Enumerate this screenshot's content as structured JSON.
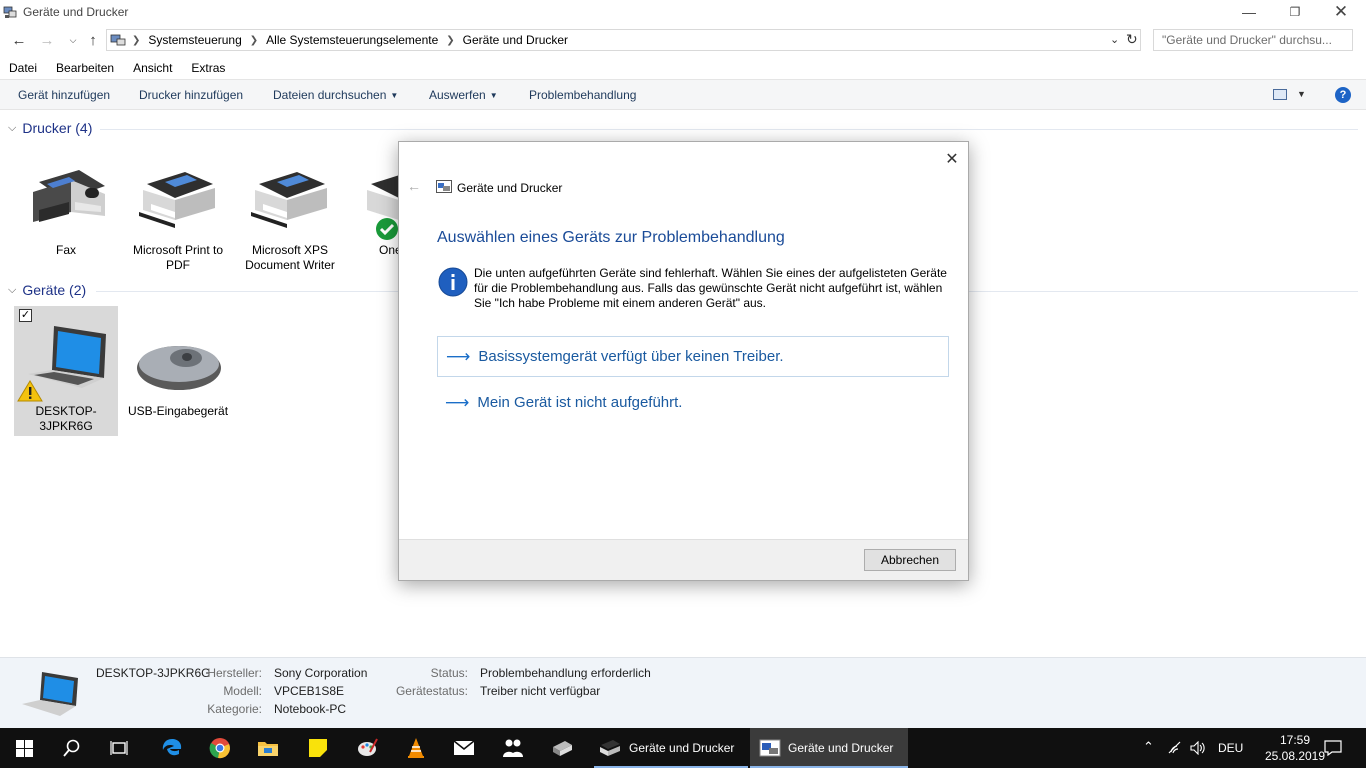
{
  "window": {
    "title": "Geräte und Drucker"
  },
  "address": {
    "crumbs": [
      "Systemsteuerung",
      "Alle Systemsteuerungselemente",
      "Geräte und Drucker"
    ],
    "search_placeholder": "\"Geräte und Drucker\" durchsu..."
  },
  "menu": [
    "Datei",
    "Bearbeiten",
    "Ansicht",
    "Extras"
  ],
  "commands": {
    "add_device": "Gerät hinzufügen",
    "add_printer": "Drucker hinzufügen",
    "browse_files": "Dateien durchsuchen",
    "eject": "Auswerfen",
    "troubleshoot": "Problembehandlung",
    "help": "?"
  },
  "groups": {
    "printers": {
      "title": "Drucker (4)",
      "items": [
        {
          "label": "Fax"
        },
        {
          "label": "Microsoft Print to PDF"
        },
        {
          "label": "Microsoft XPS Document Writer"
        },
        {
          "label": "One"
        }
      ]
    },
    "devices": {
      "title": "Geräte (2)",
      "items": [
        {
          "label": "DESKTOP-3JPKR6G"
        },
        {
          "label": "USB-Eingabegerät"
        }
      ]
    }
  },
  "dialog": {
    "app_name": "Geräte und Drucker",
    "heading": "Auswählen eines Geräts zur Problembehandlung",
    "info": "Die unten aufgeführten Geräte sind fehlerhaft. Wählen Sie eines der aufgelisteten Geräte für die Problembehandlung aus. Falls das gewünschte Gerät nicht aufgeführt ist, wählen Sie \"Ich habe Probleme mit einem anderen Gerät\" aus.",
    "options": [
      "Basissystemgerät verfügt über keinen Treiber.",
      "Mein Gerät ist nicht aufgeführt."
    ],
    "cancel": "Abbrechen"
  },
  "details": {
    "name": "DESKTOP-3JPKR6G",
    "manufacturer_label": "Hersteller:",
    "manufacturer": "Sony Corporation",
    "model_label": "Modell:",
    "model": "VPCEB1S8E",
    "category_label": "Kategorie:",
    "category": "Notebook-PC",
    "status_label": "Status:",
    "status": "Problembehandlung erforderlich",
    "device_status_label": "Gerätestatus:",
    "device_status": "Treiber nicht verfügbar"
  },
  "taskbar": {
    "tasks": [
      "Geräte und Drucker",
      "Geräte und Drucker"
    ],
    "language": "DEU",
    "time": "17:59",
    "date": "25.08.2019"
  },
  "colors": {
    "accent": "#1a5aa0",
    "taskbar": "#101010",
    "details_bg": "#f0f4f9"
  }
}
